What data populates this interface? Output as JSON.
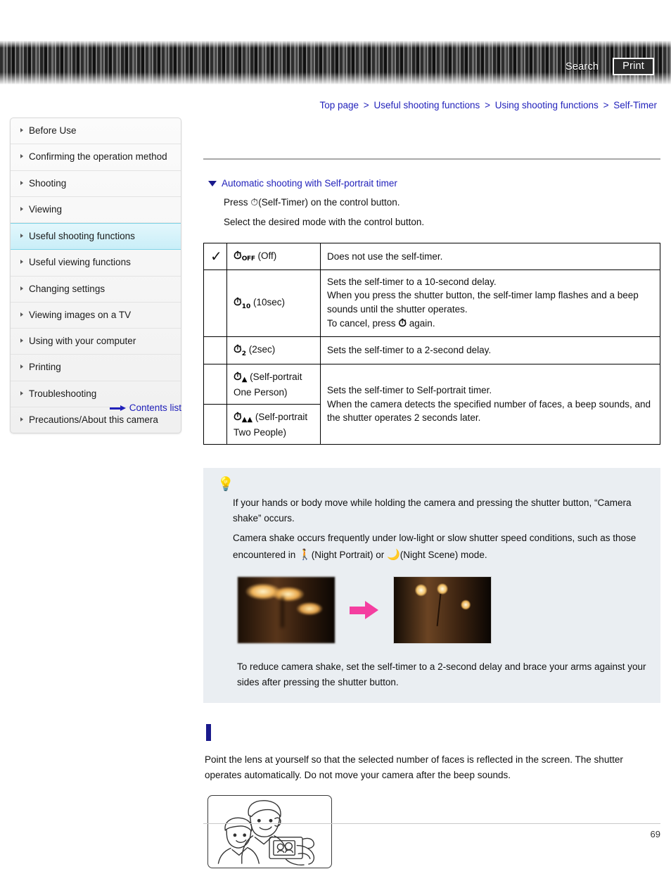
{
  "header": {
    "search_label": "Search",
    "print_label": "Print"
  },
  "breadcrumb": {
    "separator": ">",
    "items": [
      {
        "label": "Top page"
      },
      {
        "label": "Useful shooting functions"
      },
      {
        "label": "Using shooting functions"
      },
      {
        "label": "Self-Timer"
      }
    ]
  },
  "sidebar": {
    "items": [
      {
        "label": "Before Use",
        "active": false
      },
      {
        "label": "Confirming the operation method",
        "active": false
      },
      {
        "label": "Shooting",
        "active": false
      },
      {
        "label": "Viewing",
        "active": false
      },
      {
        "label": "Useful shooting functions",
        "active": true
      },
      {
        "label": "Useful viewing functions",
        "active": false
      },
      {
        "label": "Changing settings",
        "active": false
      },
      {
        "label": "Viewing images on a TV",
        "active": false
      },
      {
        "label": "Using with your computer",
        "active": false
      },
      {
        "label": "Printing",
        "active": false
      },
      {
        "label": "Troubleshooting",
        "active": false
      },
      {
        "label": "Precautions/About this camera",
        "active": false
      }
    ],
    "contents_list_label": "Contents list"
  },
  "main": {
    "section_heading": "Automatic shooting with Self-portrait timer",
    "step_1_prefix": "Press",
    "step_1_icon": "self-timer-icon",
    "step_1_suffix": "(Self-Timer) on the control button.",
    "step_2": "Select the desired mode with the control button.",
    "table": {
      "rows": [
        {
          "checked": true,
          "icon": "self-timer-off-icon",
          "icon_sub": "OFF",
          "mode": "(Off)",
          "description": "Does not use the self-timer."
        },
        {
          "checked": false,
          "icon": "self-timer-10sec-icon",
          "icon_sub": "10",
          "mode": "(10sec)",
          "description_lines": [
            "Sets the self-timer to a 10-second delay.",
            "When you press the shutter button, the self-timer lamp flashes and a beep sounds until the shutter operates."
          ],
          "description_last_prefix": "To cancel, press",
          "description_last_suffix": "again."
        },
        {
          "checked": false,
          "icon": "self-timer-2sec-icon",
          "icon_sub": "2",
          "mode": "(2sec)",
          "description": "Sets the self-timer to a 2-second delay."
        },
        {
          "checked": false,
          "icon": "self-timer-self-portrait-one-icon",
          "icon_sub": "person",
          "mode": "(Self-portrait One Person)"
        },
        {
          "checked": false,
          "icon": "self-timer-self-portrait-two-icon",
          "icon_sub": "two-people",
          "mode": "(Self-portrait Two People)"
        }
      ],
      "self_portrait_description_lines": [
        "Sets the self-timer to Self-portrait timer.",
        "When the camera detects the specified number of faces, a beep sounds, and the shutter operates 2 seconds later."
      ]
    },
    "tip": {
      "icon": "lightbulb-tip-icon",
      "paragraph_1": "If your hands or body move while holding the camera and pressing the shutter button, “Camera shake” occurs.",
      "paragraph_2_prefix": "Camera shake occurs frequently under low-light or slow shutter speed conditions, such as those encountered in",
      "night_portrait_label": "(Night Portrait) or",
      "night_scene_label": "(Night Scene) mode.",
      "image_before_alt": "blurred-chandelier-photo",
      "image_after_alt": "sharp-chandelier-photo",
      "arrow_alt": "pink-arrow-icon",
      "footnote": "To reduce camera shake, set the self-timer to a 2-second delay and brace your arms against your sides after pressing the shutter button."
    },
    "bottom": {
      "marker": "section-marker",
      "text": "Point the lens at yourself so that the selected number of faces is reflected in the screen. The shutter operates automatically. Do not move your camera after the beep sounds.",
      "illustration_alt": "two-people-selfie-illustration"
    }
  },
  "footer": {
    "page_number": "69"
  }
}
